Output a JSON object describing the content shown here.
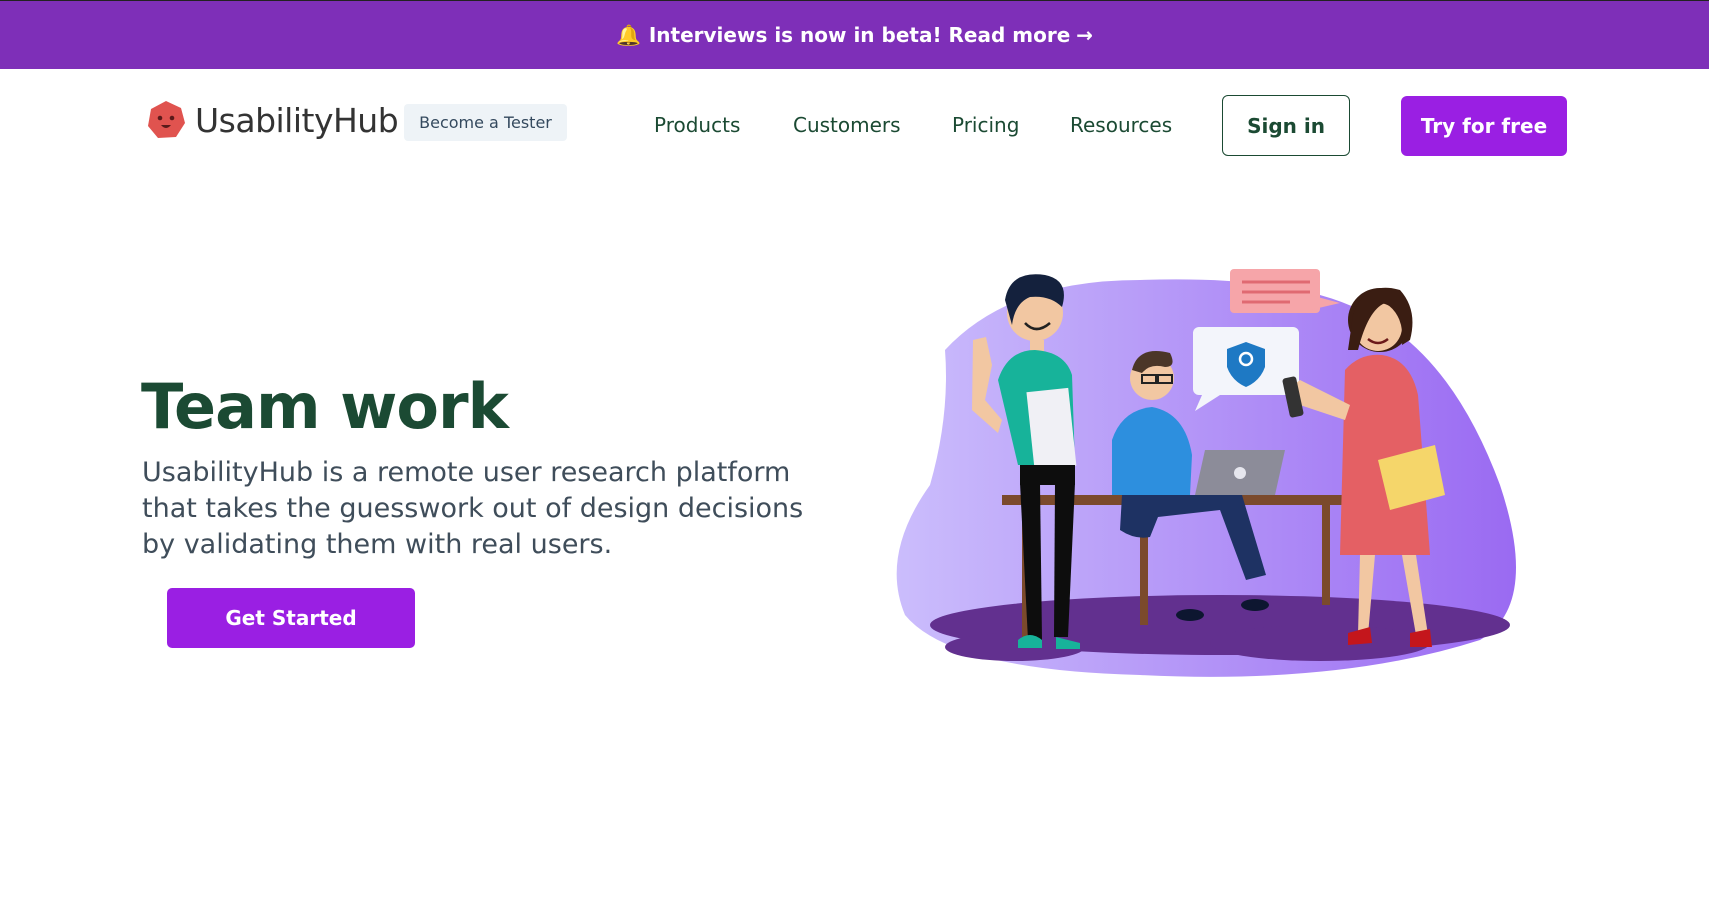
{
  "banner": {
    "icon": "bell-icon",
    "text": "Interviews is now in beta! Read more",
    "arrow": "→"
  },
  "header": {
    "logo_text": "UsabilityHub",
    "become_tester": "Become a Tester",
    "nav": [
      "Products",
      "Customers",
      "Pricing",
      "Resources"
    ],
    "sign_in": "Sign in",
    "try_free": "Try for free"
  },
  "hero": {
    "title": "Team work",
    "description": "UsabilityHub is a remote user research platform that takes the guesswork out of design decisions by validating them with real users.",
    "cta": "Get Started"
  },
  "colors": {
    "banner_bg": "#7e2fb8",
    "accent": "#9a1fe3",
    "heading": "#1b4a33",
    "body_text": "#3f4d5a"
  }
}
